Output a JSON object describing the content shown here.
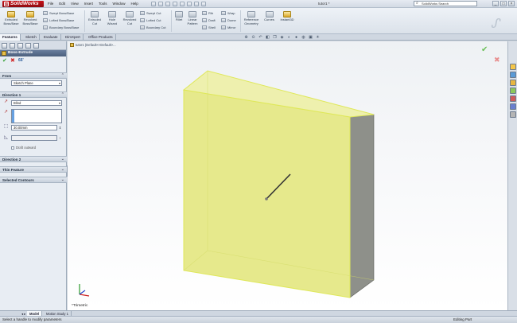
{
  "app": {
    "logo_text": "SolidWorks",
    "document_title": "tutor1 *",
    "menu": [
      "File",
      "Edit",
      "View",
      "Insert",
      "Tools",
      "Window",
      "Help"
    ],
    "search_placeholder": "SolidWorks Search",
    "window_buttons": [
      "_",
      "□",
      "×"
    ]
  },
  "ribbon": {
    "large_buttons": [
      {
        "label1": "Extruded",
        "label2": "Boss/Base"
      },
      {
        "label1": "Revolved",
        "label2": "Boss/Base"
      },
      {
        "label1": "Extruded",
        "label2": "Cut"
      },
      {
        "label1": "Hole",
        "label2": "Wizard"
      },
      {
        "label1": "Revolved",
        "label2": "Cut"
      },
      {
        "label1": "Fillet",
        "label2": ""
      },
      {
        "label1": "Linear",
        "label2": "Pattern"
      },
      {
        "label1": "Reference",
        "label2": "Geometry"
      },
      {
        "label1": "Curves",
        "label2": ""
      },
      {
        "label1": "Instant3D",
        "label2": ""
      }
    ],
    "small_buttons": {
      "swept_boss": "Swept Boss/Base",
      "lofted_boss": "Lofted Boss/Base",
      "boundary_boss": "Boundary Boss/Base",
      "swept_cut": "Swept Cut",
      "lofted_cut": "Lofted Cut",
      "boundary_cut": "Boundary Cut",
      "rib": "Rib",
      "draft": "Draft",
      "shell": "Shell",
      "wrap": "Wrap",
      "dome": "Dome",
      "mirror": "Mirror"
    }
  },
  "tabs": [
    "Features",
    "Sketch",
    "Evaluate",
    "DimXpert",
    "Office Products"
  ],
  "property_manager": {
    "title": "Boss-Extrude",
    "ok": "✔",
    "cancel": "✖",
    "detail": "66'",
    "from_group": "From",
    "from_value": "Sketch Plane",
    "direction1_group": "Direction 1",
    "end_condition": "Blind",
    "depth_value": "30.00mm",
    "draft_outward": "Draft outward",
    "direction2_group": "Direction 2",
    "thin_feature_group": "Thin Feature",
    "selected_contours_group": "Selected Contours"
  },
  "viewport": {
    "tree_flyout": "tutor1 (Default<<Default>...",
    "view_orientation": "*Trimetric",
    "confirm_ok": "✔",
    "confirm_cancel": "✖"
  },
  "bottom_tabs": [
    "Model",
    "Motion Study 1"
  ],
  "status": {
    "left": "Select a handle to modify parameters",
    "right": "Editing Part"
  },
  "colors": {
    "accent_red": "#c9141b",
    "selected_face": "#e9ec93",
    "edge_highlight": "#dfe85a",
    "side_face": "#8e908a"
  }
}
